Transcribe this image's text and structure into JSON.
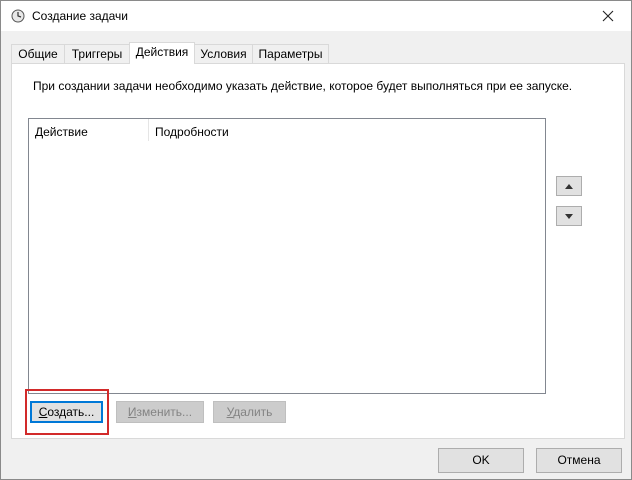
{
  "window": {
    "title": "Создание задачи",
    "icons": {
      "app": "task-clock-icon",
      "close": "close-icon"
    }
  },
  "tabs": [
    {
      "label": "Общие"
    },
    {
      "label": "Триггеры"
    },
    {
      "label": "Действия",
      "active": true
    },
    {
      "label": "Условия"
    },
    {
      "label": "Параметры"
    }
  ],
  "actions": {
    "description": "При создании задачи необходимо указать действие, которое будет выполняться при ее запуске.",
    "columns": [
      "Действие",
      "Подробности"
    ],
    "rows": [],
    "move_up_icon": "triangle-up-icon",
    "move_down_icon": "triangle-down-icon",
    "buttons": {
      "create": {
        "label": "Создать...",
        "hotkey": "С",
        "rest": "оздать..."
      },
      "edit": {
        "label": "Изменить...",
        "hotkey": "И",
        "rest": "зменить...",
        "disabled": true
      },
      "delete": {
        "label": "Удалить",
        "hotkey": "У",
        "rest": "далить",
        "disabled": true
      }
    },
    "highlight_color": "#d22a2a"
  },
  "footer": {
    "ok_label": "OK",
    "cancel_label": "Отмена"
  }
}
